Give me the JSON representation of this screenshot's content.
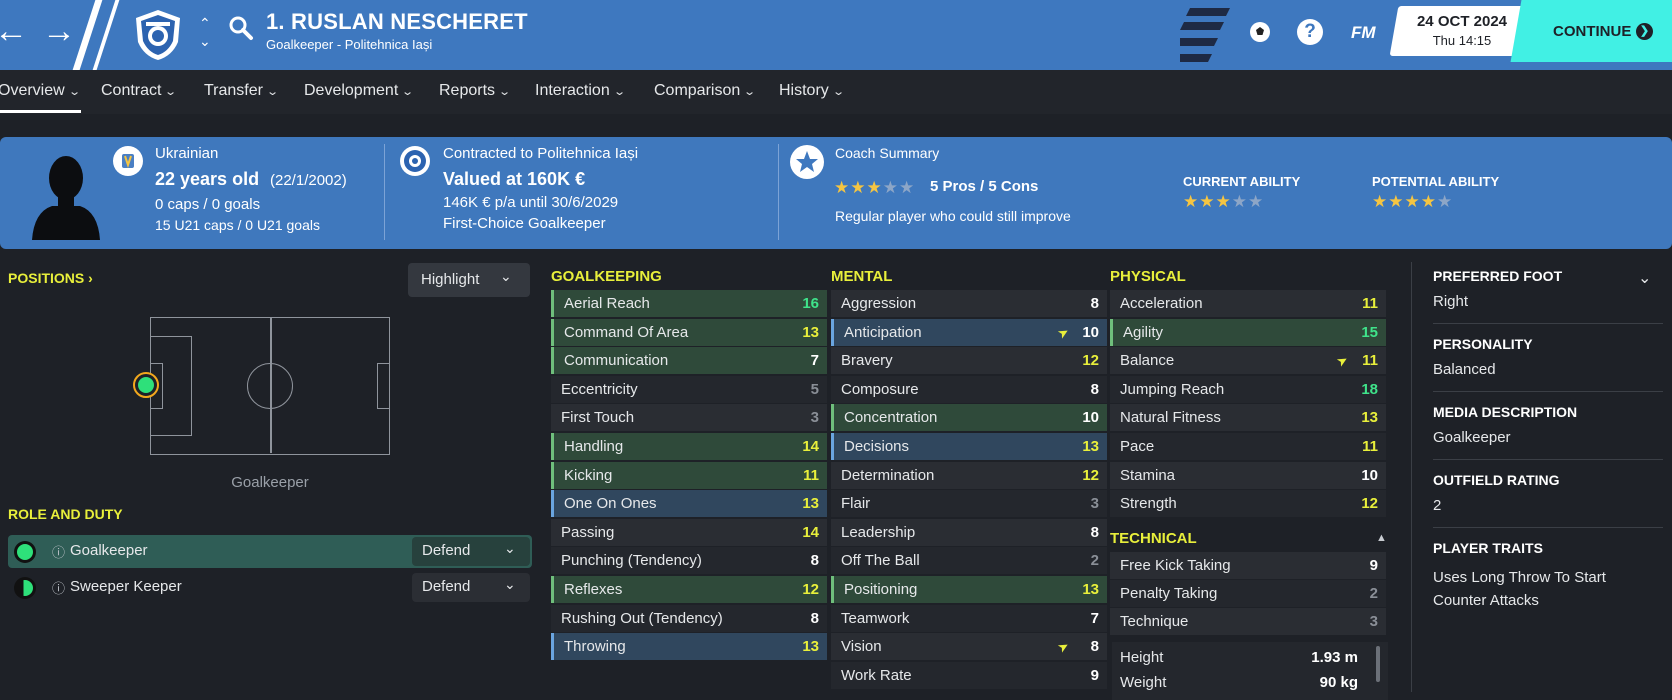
{
  "header": {
    "player_name": "1. RUSLAN NESCHERET",
    "player_subtitle": "Goalkeeper - Politehnica Iași",
    "date": "24 OCT 2024",
    "time": "Thu 14:15",
    "continue_label": "CONTINUE",
    "fm_label": "FM",
    "help_label": "?",
    "back_icon": "arrow-left-icon",
    "forward_icon": "arrow-right-icon",
    "brand_color": "#3e78bf",
    "continue_color": "#41f0e4"
  },
  "tabs": [
    {
      "label": "Overview"
    },
    {
      "label": "Contract"
    },
    {
      "label": "Transfer"
    },
    {
      "label": "Development"
    },
    {
      "label": "Reports"
    },
    {
      "label": "Interaction"
    },
    {
      "label": "Comparison"
    },
    {
      "label": "History"
    }
  ],
  "summary": {
    "nationality": "Ukrainian",
    "age": "22 years old",
    "dob": "(22/1/2002)",
    "caps": "0 caps / 0 goals",
    "u21_caps": "15 U21 caps / 0 U21 goals",
    "contract_title": "Contracted to Politehnica Iași",
    "value": "Valued at 160K €",
    "wage": "146K € p/a until 30/6/2029",
    "squad_status": "First-Choice Goalkeeper",
    "coach_title": "Coach Summary",
    "coach_stars": 3,
    "pros_cons": "5 Pros / 5 Cons",
    "coach_note": "Regular player who could still improve",
    "current_ability_label": "CURRENT ABILITY",
    "current_ability_stars": 3,
    "potential_ability_label": "POTENTIAL ABILITY",
    "potential_ability_stars": 4
  },
  "positions": {
    "title": "POSITIONS",
    "dropdown": "Highlight",
    "position_label": "Goalkeeper",
    "role_title": "ROLE AND DUTY",
    "roles": [
      {
        "name": "Goalkeeper",
        "duty": "Defend"
      },
      {
        "name": "Sweeper Keeper",
        "duty": "Defend"
      }
    ]
  },
  "goalkeeping": {
    "title": "GOALKEEPING",
    "attrs": [
      {
        "name": "Aerial Reach",
        "value": "16",
        "hl": "green"
      },
      {
        "name": "Command Of Area",
        "value": "13",
        "hl": "green"
      },
      {
        "name": "Communication",
        "value": "7",
        "hl": "green"
      },
      {
        "name": "Eccentricity",
        "value": "5",
        "hl": "none"
      },
      {
        "name": "First Touch",
        "value": "3",
        "hl": "none"
      },
      {
        "name": "Handling",
        "value": "14",
        "hl": "green"
      },
      {
        "name": "Kicking",
        "value": "11",
        "hl": "green"
      },
      {
        "name": "One On Ones",
        "value": "13",
        "hl": "blue"
      },
      {
        "name": "Passing",
        "value": "14",
        "hl": "none"
      },
      {
        "name": "Punching (Tendency)",
        "value": "8",
        "hl": "none"
      },
      {
        "name": "Reflexes",
        "value": "12",
        "hl": "green"
      },
      {
        "name": "Rushing Out (Tendency)",
        "value": "8",
        "hl": "none"
      },
      {
        "name": "Throwing",
        "value": "13",
        "hl": "blue"
      }
    ]
  },
  "mental": {
    "title": "MENTAL",
    "attrs": [
      {
        "name": "Aggression",
        "value": "8",
        "hl": "none"
      },
      {
        "name": "Anticipation",
        "value": "10",
        "hl": "blue",
        "arrow": true
      },
      {
        "name": "Bravery",
        "value": "12",
        "hl": "none"
      },
      {
        "name": "Composure",
        "value": "8",
        "hl": "none"
      },
      {
        "name": "Concentration",
        "value": "10",
        "hl": "green"
      },
      {
        "name": "Decisions",
        "value": "13",
        "hl": "blue"
      },
      {
        "name": "Determination",
        "value": "12",
        "hl": "none"
      },
      {
        "name": "Flair",
        "value": "3",
        "hl": "none"
      },
      {
        "name": "Leadership",
        "value": "8",
        "hl": "none"
      },
      {
        "name": "Off The Ball",
        "value": "2",
        "hl": "none"
      },
      {
        "name": "Positioning",
        "value": "13",
        "hl": "green"
      },
      {
        "name": "Teamwork",
        "value": "7",
        "hl": "none"
      },
      {
        "name": "Vision",
        "value": "8",
        "hl": "none",
        "arrow": true
      },
      {
        "name": "Work Rate",
        "value": "9",
        "hl": "none"
      }
    ]
  },
  "physical": {
    "title": "PHYSICAL",
    "attrs": [
      {
        "name": "Acceleration",
        "value": "11",
        "hl": "none"
      },
      {
        "name": "Agility",
        "value": "15",
        "hl": "green"
      },
      {
        "name": "Balance",
        "value": "11",
        "hl": "none",
        "arrow": true
      },
      {
        "name": "Jumping Reach",
        "value": "18",
        "hl": "none"
      },
      {
        "name": "Natural Fitness",
        "value": "13",
        "hl": "none"
      },
      {
        "name": "Pace",
        "value": "11",
        "hl": "none"
      },
      {
        "name": "Stamina",
        "value": "10",
        "hl": "none"
      },
      {
        "name": "Strength",
        "value": "12",
        "hl": "none"
      }
    ]
  },
  "technical": {
    "title": "TECHNICAL",
    "attrs": [
      {
        "name": "Free Kick Taking",
        "value": "9",
        "hl": "none"
      },
      {
        "name": "Penalty Taking",
        "value": "2",
        "hl": "none"
      },
      {
        "name": "Technique",
        "value": "3",
        "hl": "none"
      }
    ],
    "height_label": "Height",
    "height": "1.93 m",
    "weight_label": "Weight",
    "weight": "90 kg"
  },
  "sidebar": {
    "preferred_foot_title": "PREFERRED FOOT",
    "preferred_foot": "Right",
    "personality_title": "PERSONALITY",
    "personality": "Balanced",
    "media_title": "MEDIA DESCRIPTION",
    "media": "Goalkeeper",
    "outfield_title": "OUTFIELD RATING",
    "outfield": "2",
    "traits_title": "PLAYER TRAITS",
    "traits_line1": "Uses Long Throw To Start",
    "traits_line2": "Counter Attacks"
  }
}
